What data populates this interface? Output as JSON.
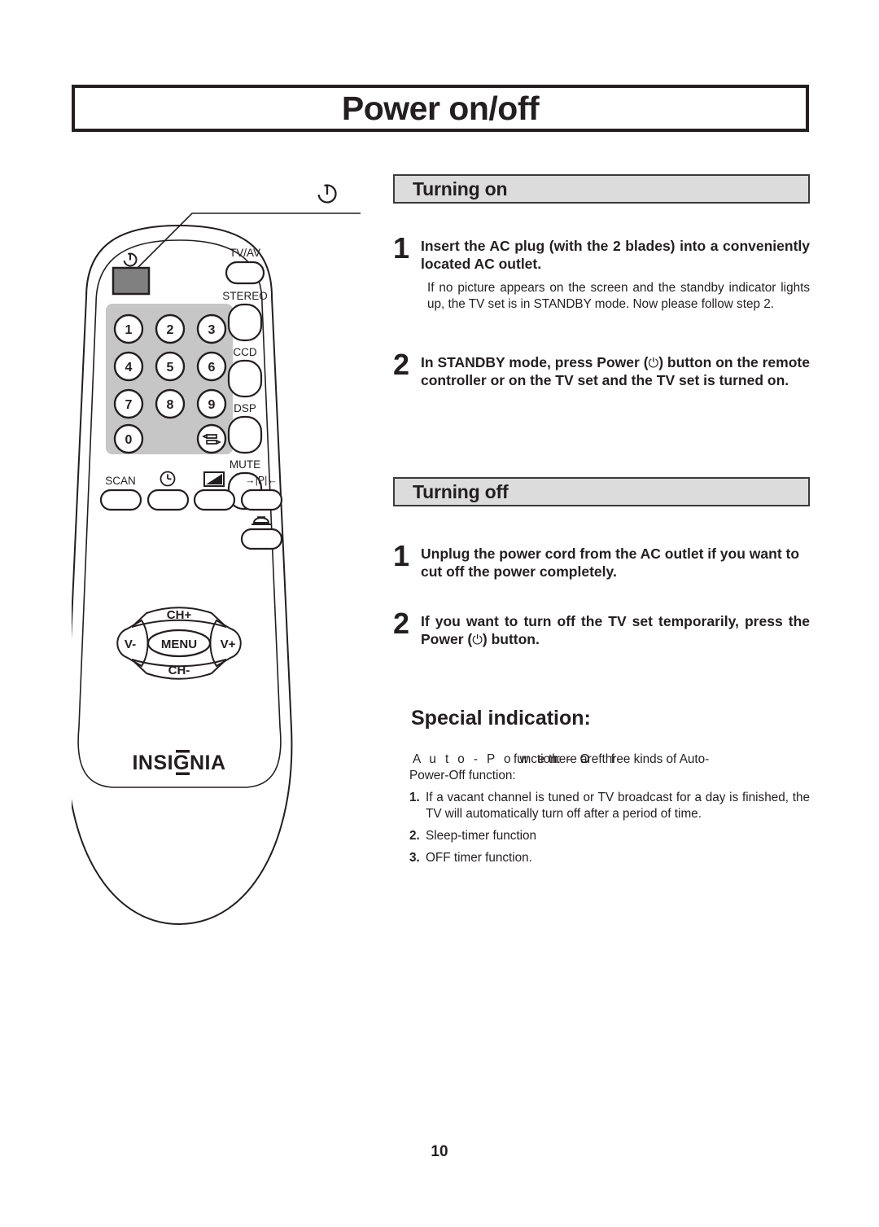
{
  "page": {
    "title": "Power on/off",
    "number": "10"
  },
  "sections": {
    "turning_on": {
      "header": "Turning on",
      "steps": [
        {
          "num": "1",
          "title": "Insert the AC plug (with the 2 blades) into a conveniently located AC outlet.",
          "note": "If no picture appears on the screen and the standby indicator lights up, the TV set is in STANDBY mode. Now please follow step 2."
        },
        {
          "num": "2",
          "title_before": "In STANDBY mode, press Power (",
          "title_glyph": "⏻",
          "title_after": ") button on the remote controller or on the TV set  and the TV set is turned on."
        }
      ]
    },
    "turning_off": {
      "header": "Turning off",
      "steps": [
        {
          "num": "1",
          "title": "Unplug the power cord from the AC outlet if you want to cut off the power completely."
        },
        {
          "num": "2",
          "title_before": "If you want to turn off the TV set temporarily, press the Power (",
          "title_glyph": "⏻",
          "title_after": ") button."
        }
      ]
    },
    "special_indication": {
      "header": "Special indication:",
      "intro_spaced": "A u t o - P o w e r - O f f",
      "intro_overlay": "function:",
      "intro_tail": "there  are  three  kinds  of  Auto-",
      "intro_line2": "Power-Off function:",
      "list": [
        {
          "num": "1",
          "text": "If a vacant channel is tuned or TV broadcast for a day is finished,  the TV will automatically turn off after a period of time."
        },
        {
          "num": "2",
          "text": "Sleep-timer function"
        },
        {
          "num": "3",
          "text": "OFF timer function."
        }
      ]
    }
  },
  "remote": {
    "brand": "INSIGNIA",
    "callout_glyph": "⏻",
    "power_button_glyph": "⏻",
    "side_buttons": [
      "TV/AV",
      "STEREO",
      "CCD",
      "DSP",
      "MUTE"
    ],
    "keypad": [
      "1",
      "2",
      "3",
      "4",
      "5",
      "6",
      "7",
      "8",
      "9",
      "0"
    ],
    "recall_label": "recall",
    "function_row": [
      "SCAN",
      "timer",
      "picture",
      "→|P|←"
    ],
    "function_row_extra": "dome",
    "nav": {
      "up": "CH+",
      "down": "CH-",
      "left": "V-",
      "right": "V+",
      "center": "MENU"
    }
  },
  "colors": {
    "frame": "#231f20",
    "header_fill": "#dcdcdc",
    "keypad_fill": "#c6c6c6",
    "power_button_fill": "#808080"
  }
}
